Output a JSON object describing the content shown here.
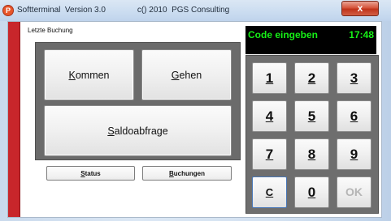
{
  "window": {
    "title": "Softterminal  Version 3.0              c() 2010  PGS Consulting",
    "close_label": "x"
  },
  "left": {
    "section_label": "Letzte Buchung",
    "buttons": {
      "kommen": {
        "underline": "K",
        "rest": "ommen"
      },
      "gehen": {
        "underline": "G",
        "rest": "ehen"
      },
      "saldo": {
        "underline": "S",
        "rest": "aldoabfrage"
      }
    },
    "small_buttons": {
      "status": {
        "underline": "S",
        "rest": "tatus"
      },
      "buchungen": {
        "underline": "B",
        "rest": "uchungen"
      }
    }
  },
  "display": {
    "prompt": "Code eingeben",
    "time": "17:48",
    "text_color": "#16f016"
  },
  "keypad": {
    "keys": [
      "1",
      "2",
      "3",
      "4",
      "5",
      "6",
      "7",
      "8",
      "9",
      "C",
      "0",
      "OK"
    ]
  },
  "colors": {
    "accent_red": "#c8262b",
    "panel_gray": "#6b6b6b",
    "display_bg": "#000000"
  }
}
